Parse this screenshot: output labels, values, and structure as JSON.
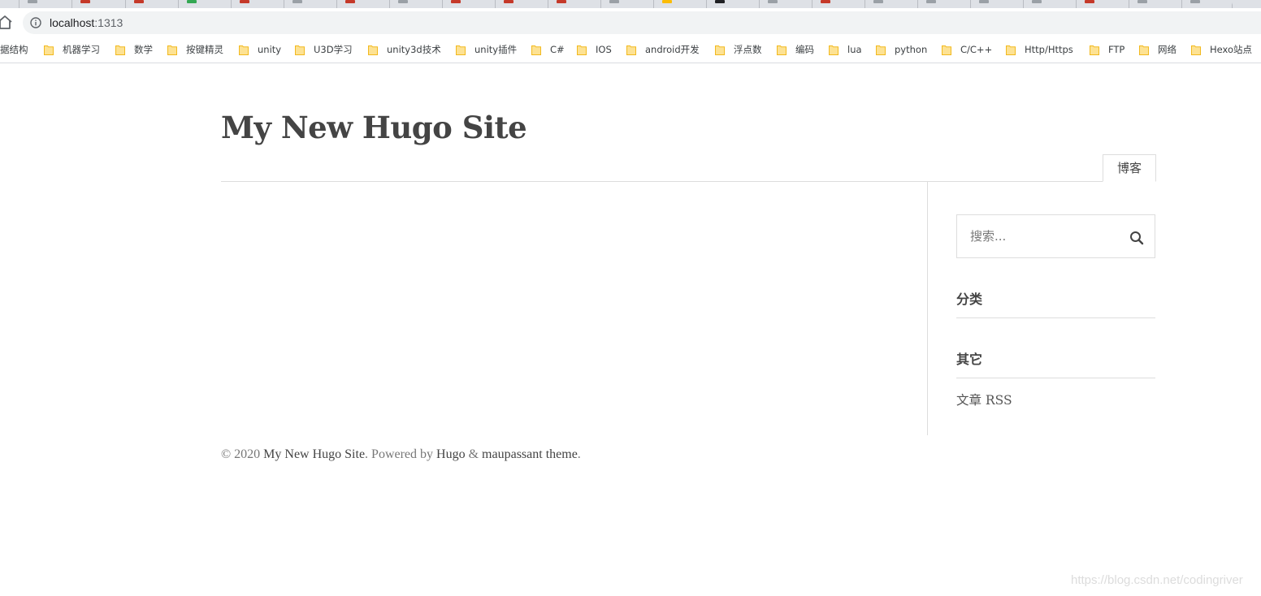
{
  "browser": {
    "url_host": "localhost",
    "url_port": ":1313",
    "bookmarks": [
      "据结构",
      "机器学习",
      "数学",
      "按键精灵",
      "unity",
      "U3D学习",
      "unity3d技术",
      "unity插件",
      "C#",
      "IOS",
      "android开发",
      "浮点数",
      "编码",
      "lua",
      "python",
      "C/C++",
      "Http/Https",
      "FTP",
      "网络",
      "Hexo站点"
    ],
    "colors": {
      "tabstrip": "#dee1e6",
      "omnibox": "#f1f3f4",
      "folder": "#f5c24a"
    }
  },
  "site": {
    "title": "My New Hugo Site",
    "nav": [
      "博客"
    ]
  },
  "sidebar": {
    "search_placeholder": "搜索...",
    "widgets": [
      {
        "title": "分类"
      },
      {
        "title": "其它",
        "links": [
          "文章 RSS"
        ]
      }
    ]
  },
  "footer": {
    "copyright": "© 2020",
    "site_link": "My New Hugo Site",
    "powered": ". Powered by",
    "hugo_link": "Hugo",
    "amp": "&",
    "theme_link": "maupassant theme",
    "end": "."
  },
  "watermark": "https://blog.csdn.net/codingriver"
}
